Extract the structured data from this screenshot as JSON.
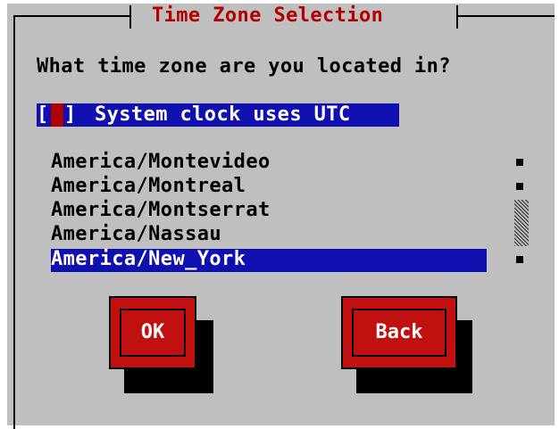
{
  "dialog": {
    "title": "Time Zone Selection",
    "question": "What time zone are you located in?"
  },
  "utc_checkbox": {
    "open_bracket": "[",
    "close_bracket": "]",
    "label": "System clock uses UTC",
    "checked": false
  },
  "timezone_list": {
    "items": [
      "America/Montevideo",
      "America/Montreal",
      "America/Montserrat",
      "America/Nassau",
      "America/New_York"
    ],
    "selected": "America/New_York"
  },
  "buttons": {
    "ok_label": "OK",
    "back_label": "Back"
  },
  "colors": {
    "background": "#bfbfbf",
    "title": "#b00000",
    "highlight": "#1010b0",
    "button": "#c01010"
  }
}
